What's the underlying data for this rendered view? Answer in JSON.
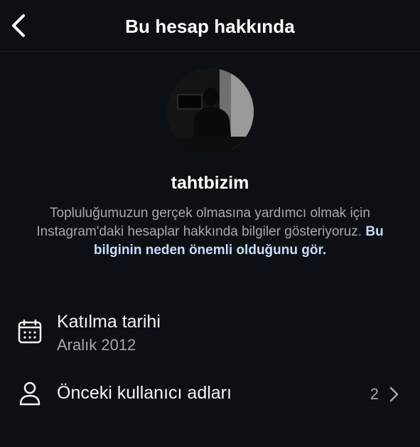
{
  "header": {
    "title": "Bu hesap hakkında",
    "back_icon": "chevron-left-icon"
  },
  "profile": {
    "username": "tahtbizim",
    "description_text": "Topluluğumuzun gerçek olmasına yardımcı olmak için Instagram'daki hesaplar hakkında bilgiler gösteriyoruz.",
    "description_link": "Bu bilginin neden önemli olduğunu gör."
  },
  "details": {
    "joined": {
      "icon": "calendar-icon",
      "label": "Katılma tarihi",
      "value": "Aralık 2012"
    },
    "former_usernames": {
      "icon": "person-icon",
      "label": "Önceki kullanıcı adları",
      "count": "2",
      "chevron_icon": "chevron-right-icon"
    }
  },
  "colors": {
    "background": "#0c1014",
    "link": "#c9dbff",
    "secondary_text": "#a8a8a8"
  }
}
